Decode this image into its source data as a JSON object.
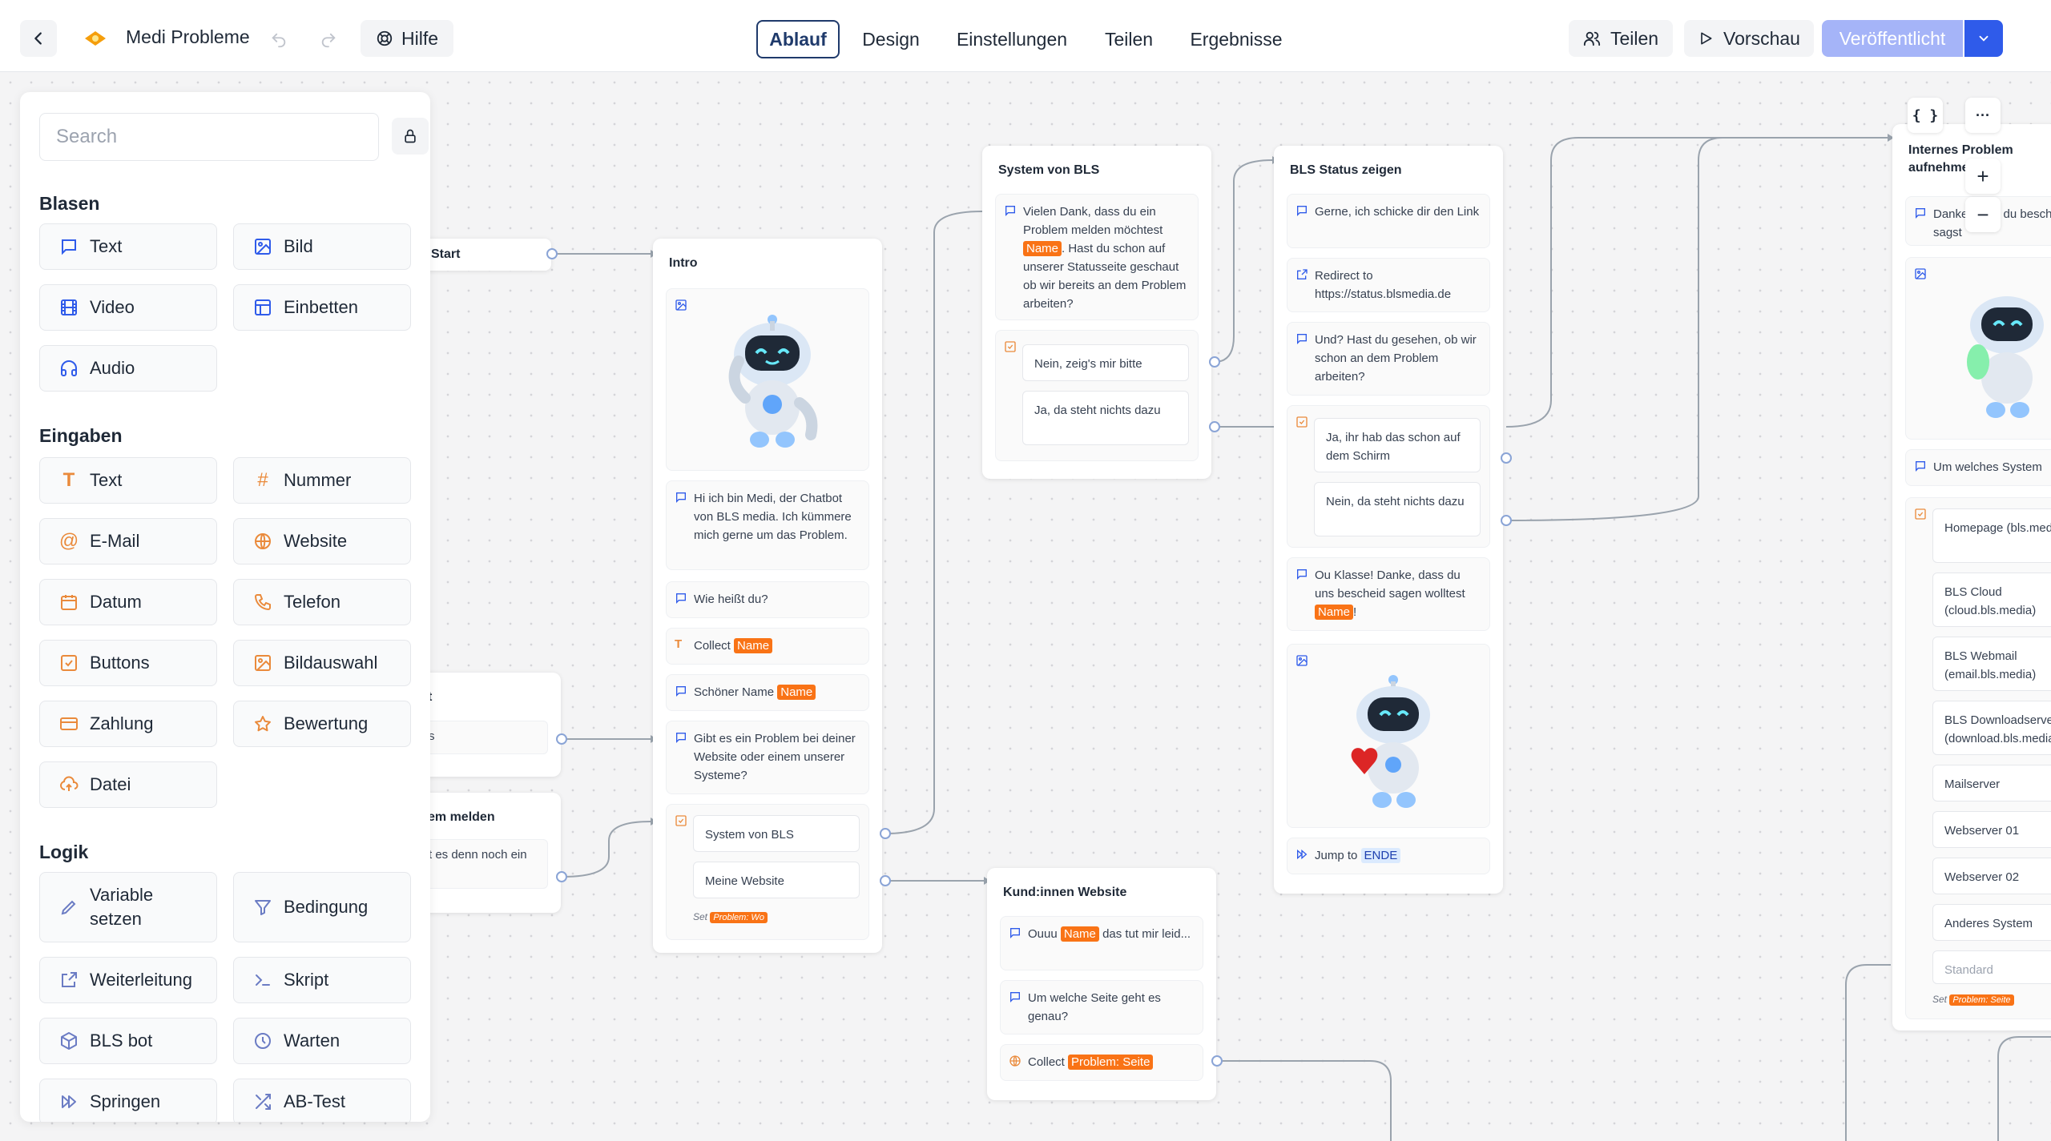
{
  "header": {
    "back_label": "back",
    "project_title": "Medi Probleme",
    "help_label": "Hilfe",
    "tabs": [
      {
        "label": "Ablauf",
        "active": true
      },
      {
        "label": "Design",
        "active": false
      },
      {
        "label": "Einstellungen",
        "active": false
      },
      {
        "label": "Teilen",
        "active": false
      },
      {
        "label": "Ergebnisse",
        "active": false
      }
    ],
    "share_label": "Teilen",
    "preview_label": "Vorschau",
    "publish_label": "Veröffentlicht"
  },
  "sidebar": {
    "search_placeholder": "Search",
    "sections": [
      {
        "title": "Blasen",
        "items": [
          {
            "label": "Text",
            "icon": "chat-bubble-icon"
          },
          {
            "label": "Bild",
            "icon": "image-icon"
          },
          {
            "label": "Video",
            "icon": "film-icon"
          },
          {
            "label": "Einbetten",
            "icon": "layout-icon"
          },
          {
            "label": "Audio",
            "icon": "headphones-icon"
          }
        ]
      },
      {
        "title": "Eingaben",
        "items": [
          {
            "label": "Text",
            "icon": "text-type-icon"
          },
          {
            "label": "Nummer",
            "icon": "hash-icon"
          },
          {
            "label": "E-Mail",
            "icon": "at-icon"
          },
          {
            "label": "Website",
            "icon": "globe-icon"
          },
          {
            "label": "Datum",
            "icon": "calendar-icon"
          },
          {
            "label": "Telefon",
            "icon": "phone-icon"
          },
          {
            "label": "Buttons",
            "icon": "checkbox-icon"
          },
          {
            "label": "Bildauswahl",
            "icon": "image-choice-icon"
          },
          {
            "label": "Zahlung",
            "icon": "credit-card-icon"
          },
          {
            "label": "Bewertung",
            "icon": "star-icon"
          },
          {
            "label": "Datei",
            "icon": "upload-cloud-icon"
          }
        ]
      },
      {
        "title": "Logik",
        "items": [
          {
            "label": "Variable setzen",
            "icon": "pencil-icon"
          },
          {
            "label": "Bedingung",
            "icon": "filter-icon"
          },
          {
            "label": "Weiterleitung",
            "icon": "external-link-icon"
          },
          {
            "label": "Skript",
            "icon": "terminal-icon"
          },
          {
            "label": "BLS bot",
            "icon": "cube-icon"
          },
          {
            "label": "Warten",
            "icon": "clock-icon"
          },
          {
            "label": "Springen",
            "icon": "fast-forward-icon"
          },
          {
            "label": "AB-Test",
            "icon": "shuffle-icon"
          }
        ]
      }
    ]
  },
  "flow": {
    "start": {
      "label": "Start"
    },
    "partial_left": [
      {
        "title": "t",
        "text": "s"
      },
      {
        "title": "em melden",
        "text": "t es denn noch ein"
      }
    ],
    "intro": {
      "title": "Intro",
      "greeting": "Hi ich bin Medi, der Chatbot von BLS media. Ich kümmere mich gerne um das Problem.",
      "ask_name": "Wie heißt du?",
      "collect_label": "Collect",
      "collect_var": "Name",
      "nice_name": "Schöner Name",
      "nice_name_var": "Name",
      "problem_question": "Gibt es ein Problem bei deiner Website oder einem unserer Systeme?",
      "choices": [
        "System von BLS",
        "Meine Website"
      ],
      "set_label": "Set",
      "set_var": "Problem: Wo"
    },
    "system": {
      "title": "System von BLS",
      "msg_pre": "Vielen Dank, dass du ein Problem melden möchtest",
      "msg_var": "Name",
      "msg_post": ". Hast du schon auf unserer Statusseite geschaut ob wir bereits an dem Problem arbeiten?",
      "choices": [
        "Nein, zeig's mir bitte",
        "Ja, da steht nichts dazu"
      ]
    },
    "status": {
      "title": "BLS Status zeigen",
      "link_msg": "Gerne, ich schicke dir den Link",
      "redirect": "Redirect to https://status.blsmedia.de",
      "question": "Und? Hast du gesehen, ob wir schon an dem Problem arbeiten?",
      "choices": [
        "Ja, ihr hab das schon auf dem Schirm",
        "Nein, da steht nichts dazu"
      ],
      "thanks_pre": "Ou Klasse! Danke, dass du uns bescheid sagen wolltest",
      "thanks_var": "Name",
      "thanks_post": "!",
      "jump_label": "Jump to",
      "jump_target": "ENDE"
    },
    "website": {
      "title": "Kund:innen Website",
      "msg_pre": "Ouuu",
      "msg_var": "Name",
      "msg_post": "das tut mir leid...",
      "question": "Um welche Seite geht es genau?",
      "collect_label": "Collect",
      "collect_var": "Problem: Seite"
    },
    "internal": {
      "title": "Internes Problem aufnehmen",
      "msg": "Danke, dass du bescheid sagst",
      "question": "Um welches System",
      "choices": [
        "Homepage (bls.media)",
        "BLS Cloud (cloud.bls.media)",
        "BLS Webmail (email.bls.media)",
        "BLS Downloadserver (download.bls.media)",
        "Mailserver",
        "Webserver 01",
        "Webserver 02",
        "Anderes System"
      ],
      "default_label": "Standard",
      "set_label": "Set",
      "set_var": "Problem: Seite"
    }
  },
  "canvas_tools": {
    "variables_label": "{ }",
    "more_label": "···",
    "zoom_in": "+",
    "zoom_out": "−"
  },
  "colors": {
    "accent": "#1f3a6b",
    "publish": "#a5b4f8",
    "publish_dropdown": "#2f5bea",
    "variable_tag": "#f97316",
    "icon_orange": "#ea8a3b",
    "connector": "#9aa3ad"
  }
}
